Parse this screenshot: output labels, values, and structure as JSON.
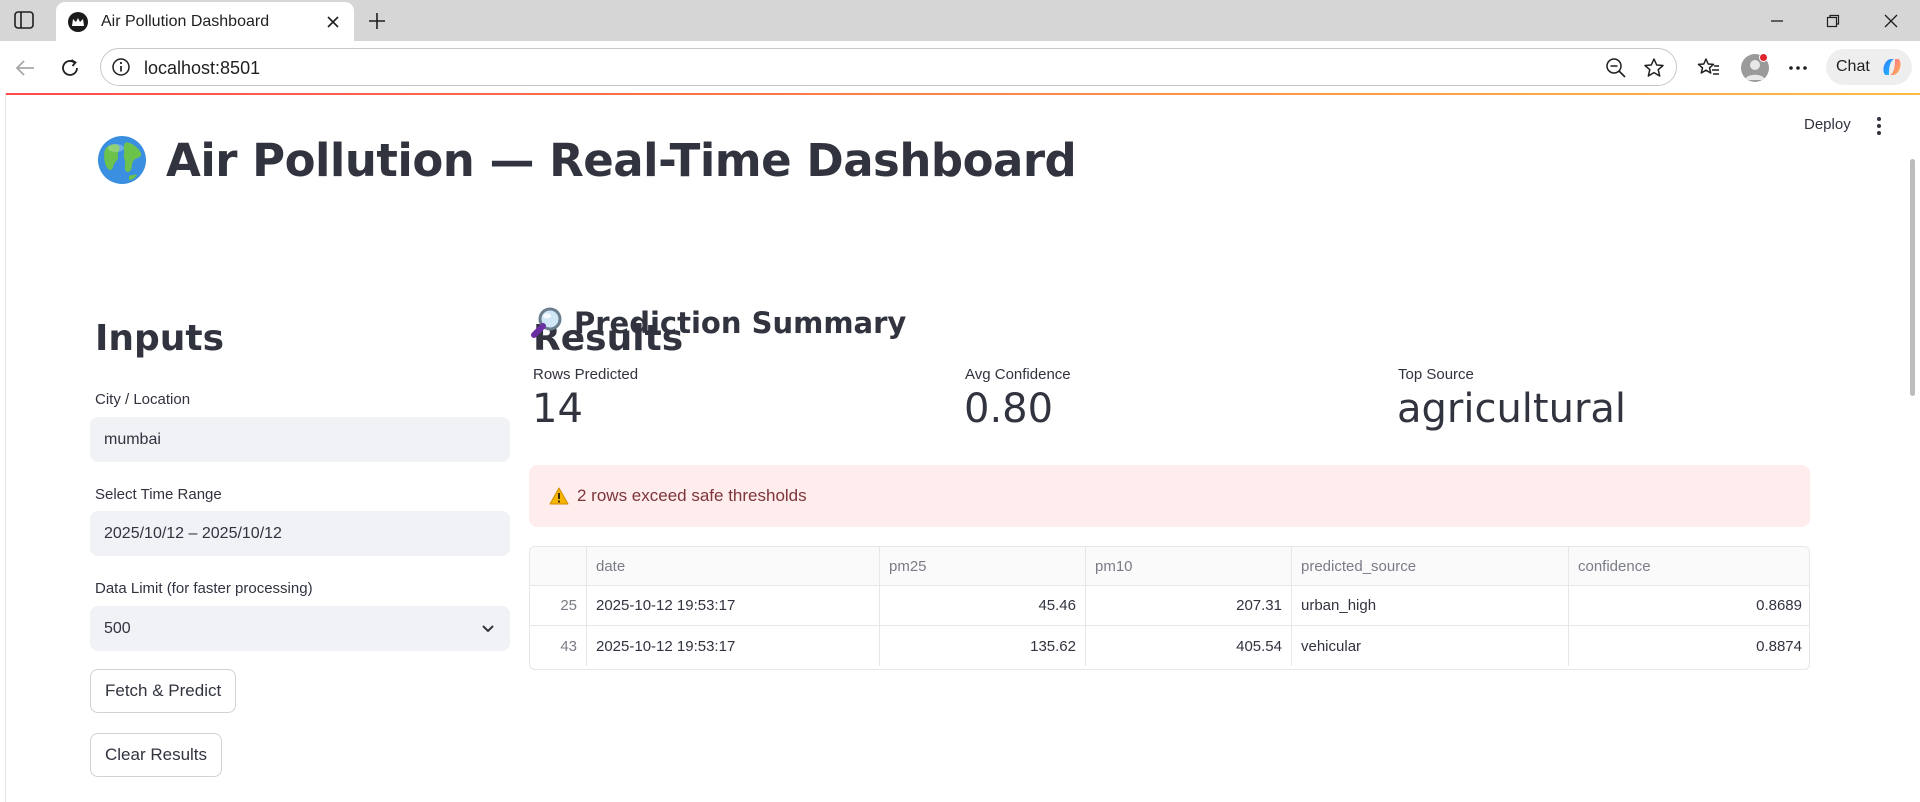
{
  "browser": {
    "tab_title": "Air Pollution Dashboard",
    "url": "localhost:8501",
    "chat_label": "Chat"
  },
  "header": {
    "deploy_label": "Deploy"
  },
  "page": {
    "title": "Air Pollution — Real-Time Dashboard"
  },
  "inputs": {
    "heading": "Inputs",
    "city_label": "City / Location",
    "city_value": "mumbai",
    "time_range_label": "Select Time Range",
    "time_range_value": "2025/10/12 – 2025/10/12",
    "limit_label": "Data Limit (for faster processing)",
    "limit_value": "500",
    "fetch_button": "Fetch & Predict",
    "clear_button": "Clear Results"
  },
  "results": {
    "heading": "Results",
    "summary_heading": "Prediction Summary",
    "metrics": [
      {
        "label": "Rows Predicted",
        "value": "14"
      },
      {
        "label": "Avg Confidence",
        "value": "0.80"
      },
      {
        "label": "Top Source",
        "value": "agricultural"
      }
    ],
    "alert_text": "2 rows exceed safe thresholds",
    "table": {
      "columns": [
        "date",
        "pm25",
        "pm10",
        "predicted_source",
        "confidence"
      ],
      "rows": [
        {
          "index": "25",
          "date": "2025-10-12 19:53:17",
          "pm25": "45.46",
          "pm10": "207.31",
          "predicted_source": "urban_high",
          "confidence": "0.8689"
        },
        {
          "index": "43",
          "date": "2025-10-12 19:53:17",
          "pm25": "135.62",
          "pm10": "405.54",
          "predicted_source": "vehicular",
          "confidence": "0.8874"
        }
      ]
    }
  },
  "colors": {
    "accent_red": "#ff4b4b",
    "alert_bg": "#ffecec",
    "alert_text": "#7d353b",
    "input_bg": "#f0f2f6"
  },
  "icons": {
    "sidebar_toggle": "sidebar-toggle-icon",
    "favicon": "streamlit-crown-icon",
    "globe": "globe-icon",
    "magnifier": "magnifier-icon",
    "warning": "warning-icon"
  }
}
